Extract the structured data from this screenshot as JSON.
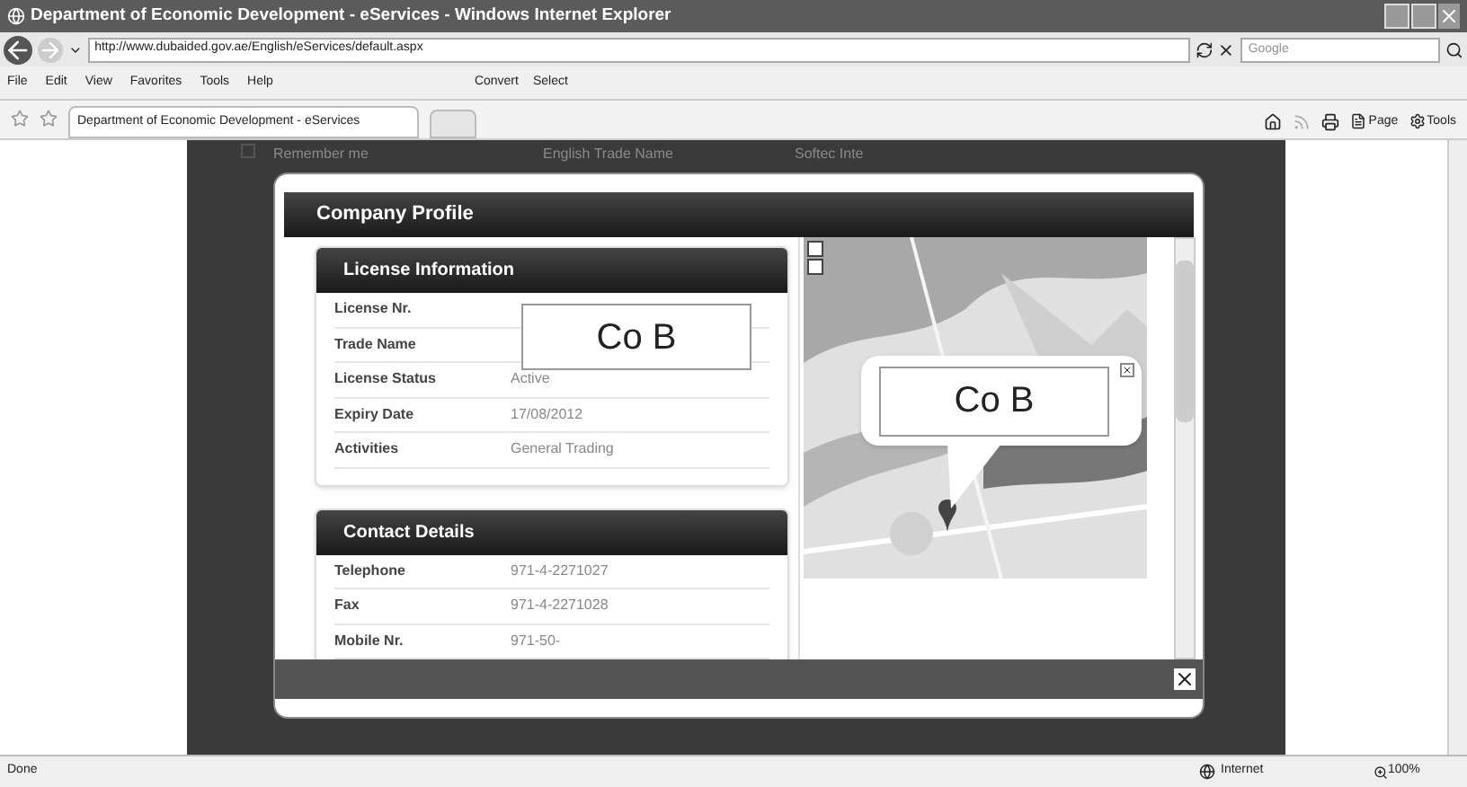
{
  "window": {
    "title": "Department of Economic Development - eServices - Windows Internet Explorer"
  },
  "address_bar": {
    "url": "http://www.dubaided.gov.ae/English/eServices/default.aspx"
  },
  "search": {
    "placeholder": "Google"
  },
  "menu": [
    "File",
    "Edit",
    "View",
    "Favorites",
    "Tools",
    "Help"
  ],
  "toolbar": [
    "Convert",
    "Select"
  ],
  "tabs": [
    {
      "label": "Department of Economic Development - eServices",
      "selected": true
    }
  ],
  "command_bar": [
    "Page",
    "Tools"
  ],
  "background_page": {
    "remember_me": {
      "label": "Remember me",
      "checked": false
    },
    "column_1": "English Trade Name",
    "column_2": "Softec Inte"
  },
  "modal": {
    "title": "Company Profile",
    "redaction": "Co B",
    "sections": [
      {
        "title": "License Information",
        "rows": [
          {
            "label": "License Nr."
          },
          {
            "label": "Trade Name"
          },
          {
            "label": "License Status",
            "value": "Active"
          },
          {
            "label": "Expiry Date",
            "value": "17/08/2012"
          },
          {
            "label": "Activities",
            "value": "General Trading"
          }
        ]
      },
      {
        "title": "Contact Details",
        "rows": [
          {
            "label": "Telephone",
            "value": "971-4-2271027"
          },
          {
            "label": "Fax",
            "value": "971-4-2271028"
          },
          {
            "label": "Mobile Nr.",
            "value": "971-50-"
          }
        ]
      }
    ],
    "map": {
      "popup": "Co B"
    }
  },
  "status_bar": {
    "text": "Done",
    "zone": "Internet",
    "zoom": "100%"
  }
}
